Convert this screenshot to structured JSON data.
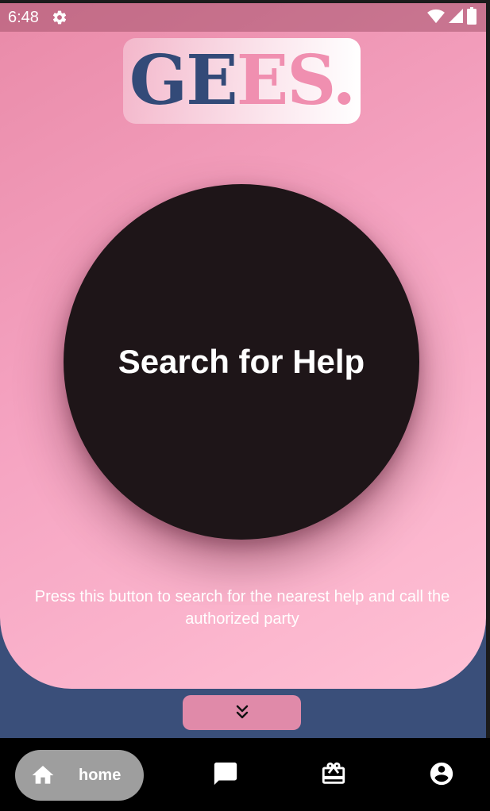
{
  "status_bar": {
    "time": "6:48",
    "icons": [
      "settings-gear-icon",
      "wifi-icon",
      "signal-icon",
      "battery-icon"
    ]
  },
  "logo": {
    "part_dark": "GE",
    "part_pink": "ES."
  },
  "main": {
    "help_button_label": "Search for Help",
    "description": "Press this button to search for the nearest help and call the authorized party"
  },
  "collapse_button": {
    "icon": "double-chevron-down-icon"
  },
  "bottom_nav": {
    "items": [
      {
        "label": "home",
        "icon": "home-icon",
        "active": true
      },
      {
        "icon": "chat-icon"
      },
      {
        "icon": "gift-card-icon"
      },
      {
        "icon": "account-icon"
      }
    ]
  },
  "colors": {
    "background_navy": "#3a4f7a",
    "panel_pink": "#f5a3c1",
    "button_dark": "#1e1518",
    "logo_navy": "#334a78",
    "logo_pink": "#f08fb0",
    "nav_active_pill": "#9e9e9e"
  }
}
